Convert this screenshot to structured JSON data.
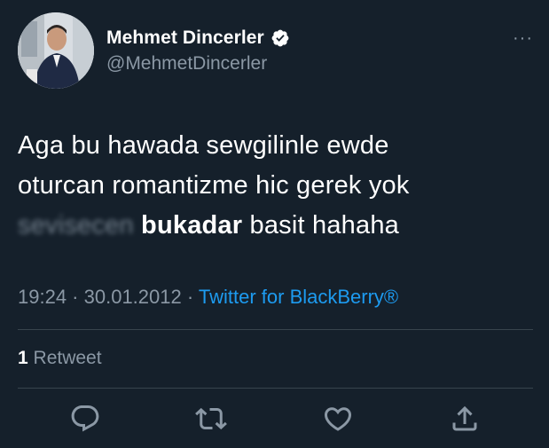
{
  "user": {
    "display_name": "Mehmet Dincerler",
    "handle": "@MehmetDincerler",
    "verified": true,
    "avatar_icon": "profile-photo"
  },
  "more_icon": "more-horizontal-icon",
  "more_label": "···",
  "tweet": {
    "line1": "Aga bu hawada sewgilinle ewde",
    "line2": "oturcan romantizme hic gerek yok",
    "blurred_word": "sevisecen",
    "bold_word": "bukadar",
    "line3_rest": " basit hahaha"
  },
  "meta": {
    "time": "19:24",
    "separator": " · ",
    "date": "30.01.2012",
    "source": "Twitter for BlackBerry®"
  },
  "stats": {
    "retweet_count": "1",
    "retweet_label": " Retweet"
  },
  "actions": [
    "reply-icon",
    "retweet-icon",
    "like-icon",
    "share-icon"
  ],
  "colors": {
    "background": "#15202b",
    "text_primary": "#ffffff",
    "text_secondary": "#8b98a5",
    "accent": "#1d9bf0",
    "divider": "#38444d"
  }
}
